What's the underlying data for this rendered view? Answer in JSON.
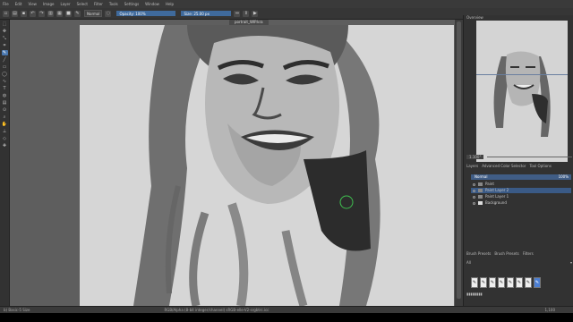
{
  "menu": [
    "File",
    "Edit",
    "View",
    "Image",
    "Layer",
    "Select",
    "Filter",
    "Tools",
    "Settings",
    "Window",
    "Help"
  ],
  "toolbar": {
    "preset_label": "Normal",
    "opacity_label": "Opacity: 100%",
    "size_label": "Size: 25.00 px",
    "buttons": [
      "new",
      "open",
      "save",
      "undo",
      "redo",
      "gradient",
      "pattern",
      "swatch",
      "brush",
      "erase",
      "alpha",
      "mirror"
    ]
  },
  "document": {
    "tab_title": "portrait_WIP.kra"
  },
  "tools": [
    "select",
    "move",
    "transform",
    "crop",
    "brush",
    "line",
    "rect",
    "ellipse",
    "path",
    "text",
    "fill",
    "gradient",
    "picker",
    "zoom",
    "pan",
    "measure",
    "assistant",
    "smart"
  ],
  "overview": {
    "title": "Overview"
  },
  "zoom_readout": "1.100°",
  "tabs": [
    "Layers",
    "Advanced Color Selector",
    "Tool Options"
  ],
  "blend_mode": "Normal",
  "opacity_readout": "100%",
  "layers": [
    {
      "name": "Paint",
      "selected": false
    },
    {
      "name": "Paint Layer 2",
      "selected": true
    },
    {
      "name": "Paint Layer 1",
      "selected": false
    },
    {
      "name": "Background",
      "selected": false
    }
  ],
  "brush_tabs": [
    "Brush Presets",
    "Brush Presets",
    "Filters"
  ],
  "brush_tag": "All",
  "status": {
    "left": "b) Basic-5 Size",
    "center": "RGB/Alpha (8-bit integer/channel)  sRGB-elle-V2-srgbtrc.icc",
    "right": "1,100"
  },
  "colors": {
    "accent": "#4a78b0",
    "selected_layer": "#3a5a86",
    "canvas": "#d6d6d6",
    "workspace": "#5e5e5e"
  }
}
